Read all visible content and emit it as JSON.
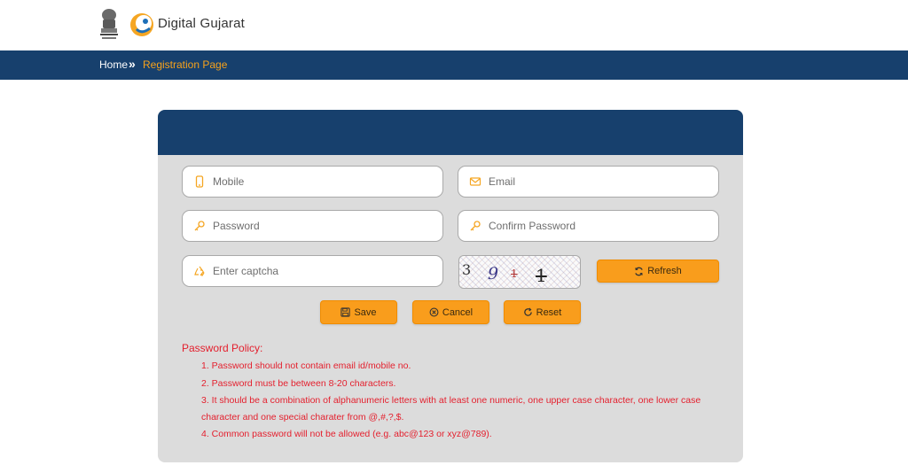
{
  "header": {
    "brand_name": "Digital Gujarat",
    "emblem_icon": "state-emblem-icon",
    "logo_icon": "digital-gujarat-logo"
  },
  "breadcrumb": {
    "home": "Home",
    "separator": "»",
    "current": "Registration Page"
  },
  "form": {
    "mobile_placeholder": "Mobile",
    "email_placeholder": "Email",
    "password_placeholder": "Password",
    "confirm_password_placeholder": "Confirm Password",
    "captcha_placeholder": "Enter captcha",
    "captcha_text": [
      "3",
      "9",
      "1",
      "1"
    ],
    "refresh_label": "Refresh",
    "save_label": "Save",
    "cancel_label": "Cancel",
    "reset_label": "Reset"
  },
  "policy": {
    "title": "Password Policy:",
    "lines": [
      "1. Password should not contain email id/mobile no.",
      "2. Password must be between 8-20 characters.",
      "3. It should be a combination of alphanumeric letters with at least one numeric, one upper case character, one lower case",
      "character and one special charater from @,#,?,$.",
      "4. Common password will not be allowed (e.g. abc@123 or xyz@789)."
    ]
  },
  "colors": {
    "navy": "#17406d",
    "accent_orange": "#f99d1c",
    "breadcrumb_current": "#f7a21b",
    "policy_red": "#e41f2d",
    "card_bg": "#dcdcdc"
  }
}
